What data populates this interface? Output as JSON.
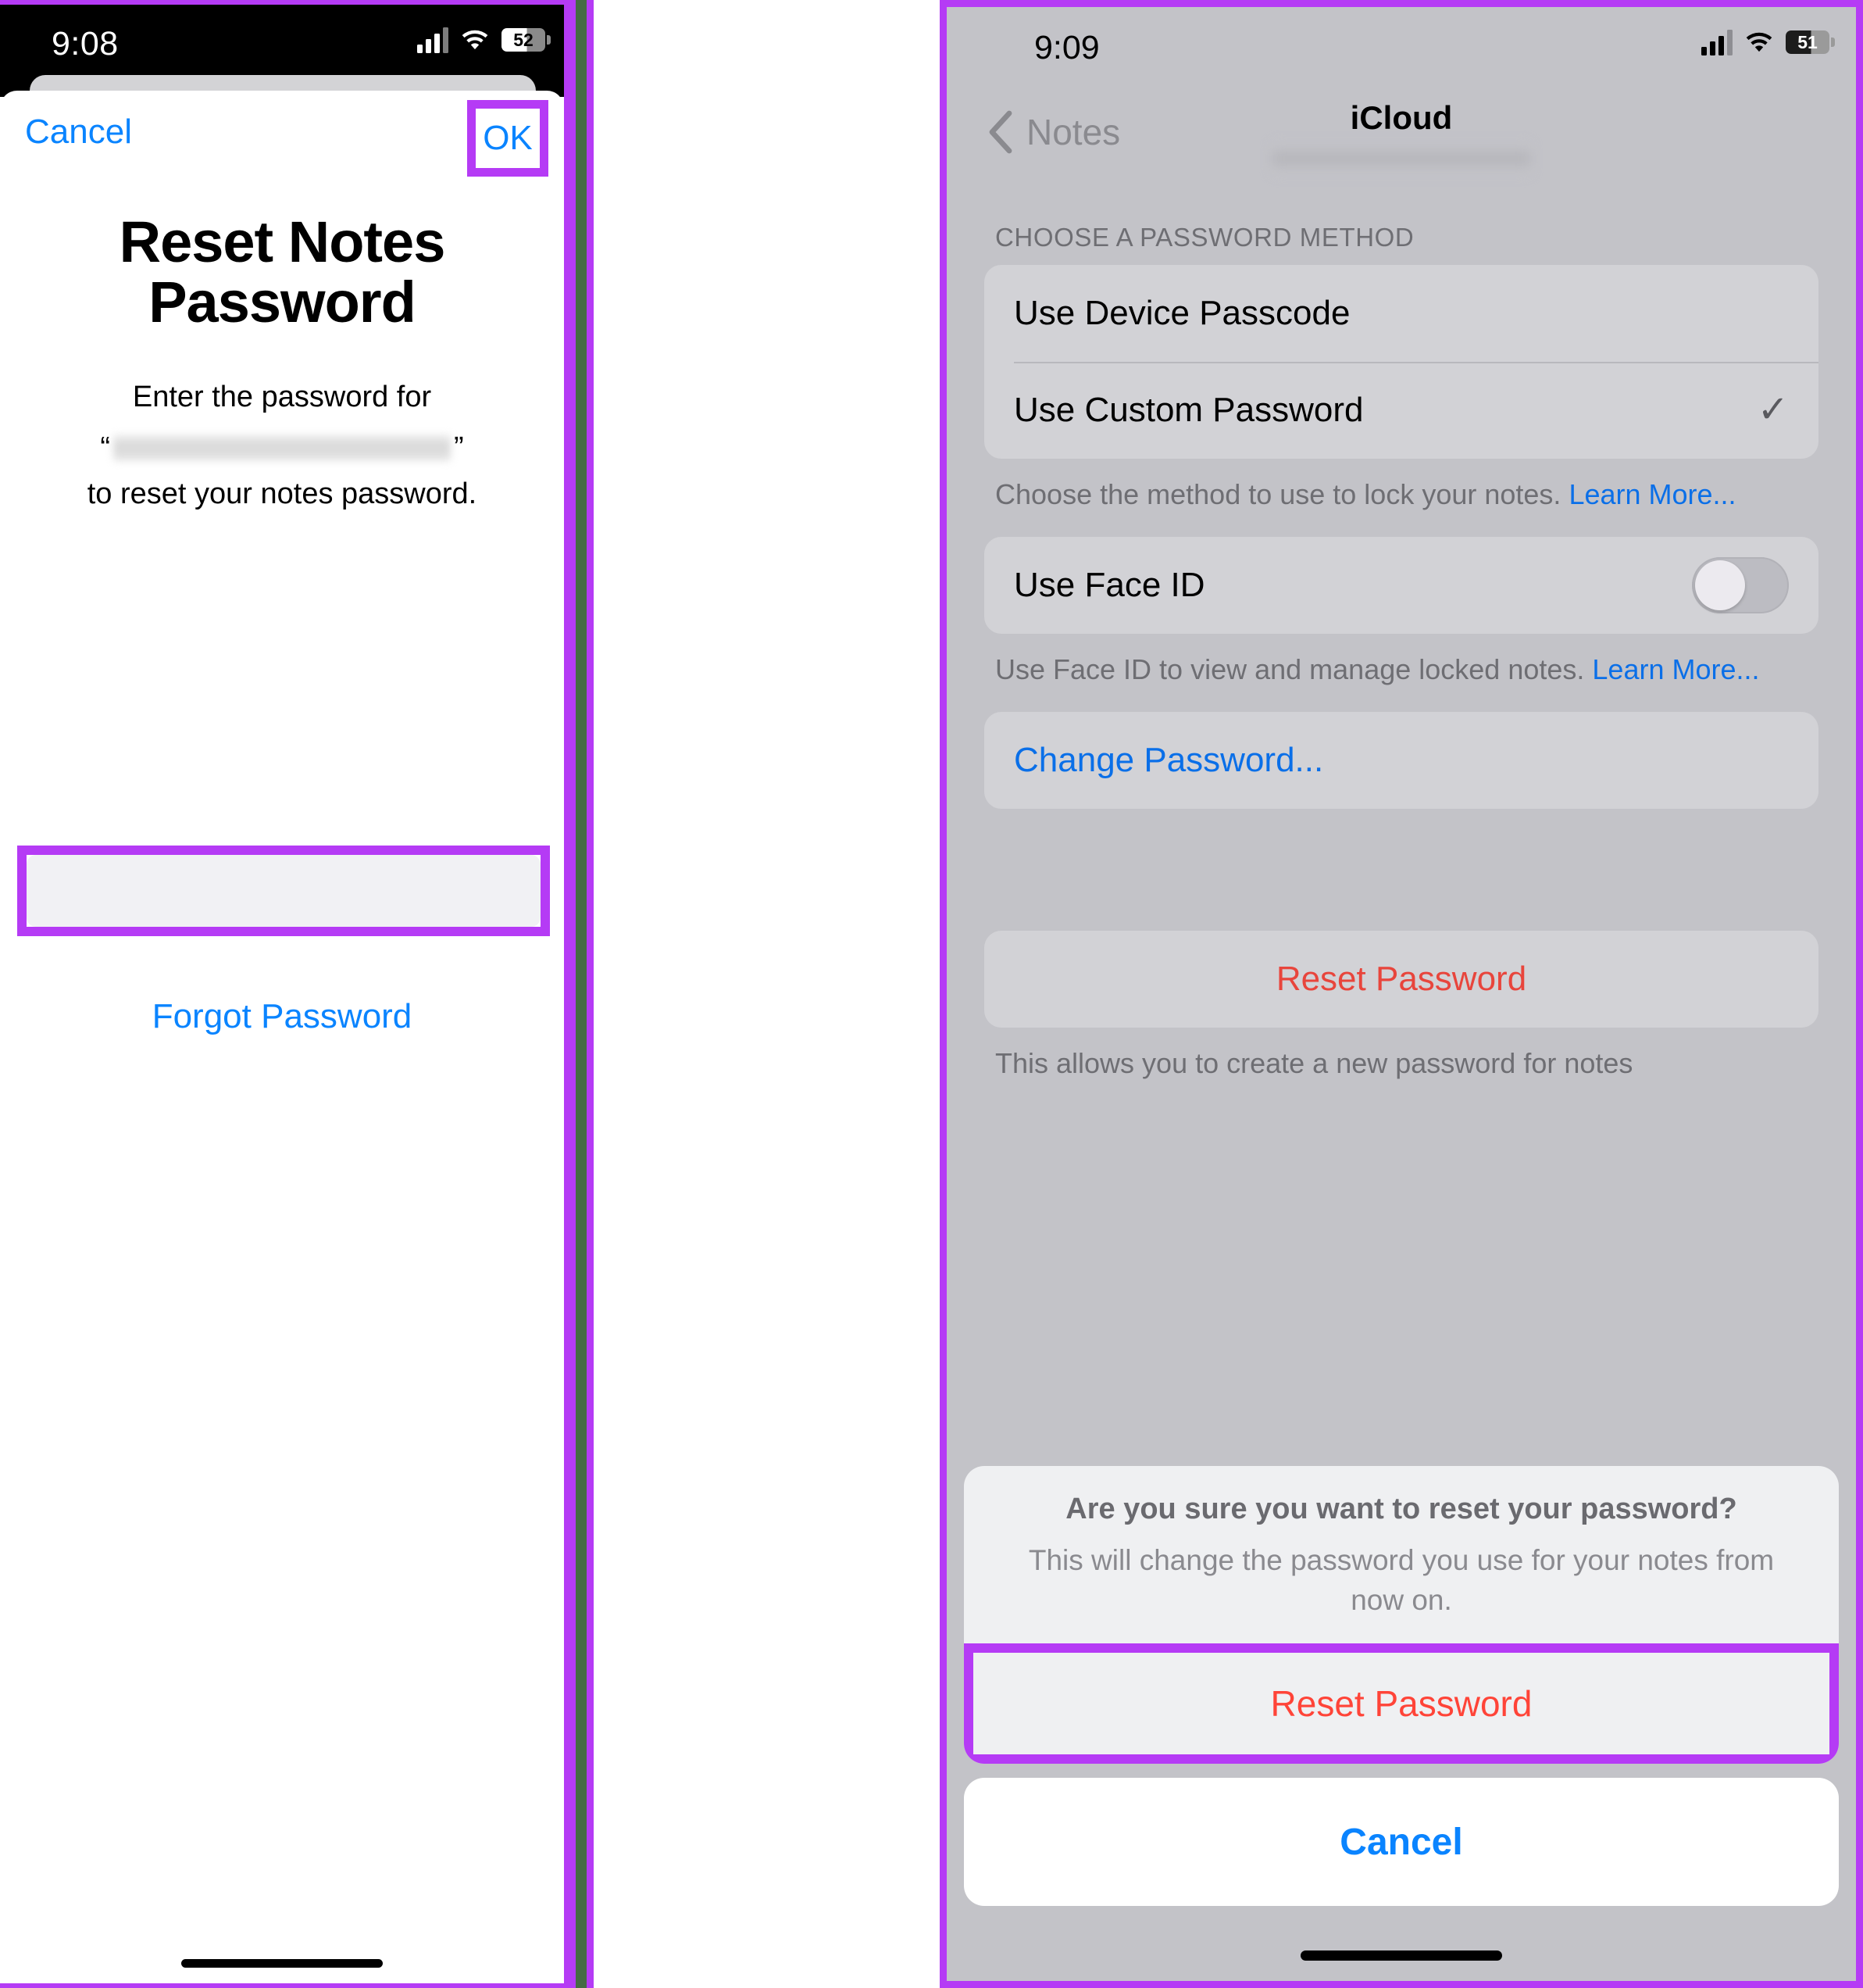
{
  "left_screen": {
    "status_bar": {
      "time": "9:08",
      "battery_percent": "52",
      "cellular_icon": "cellular-bars-icon",
      "wifi_icon": "wifi-icon",
      "battery_icon": "battery-icon"
    },
    "dialog": {
      "cancel_label": "Cancel",
      "ok_label": "OK",
      "title": "Reset Notes Password",
      "message_line1": "Enter the password for",
      "message_quote_open": "“",
      "message_quote_close": "”",
      "message_redacted_value": "",
      "message_line3": "to reset your notes password.",
      "password_input_value": "",
      "password_input_placeholder": "",
      "forgot_password_label": "Forgot Password"
    },
    "home_indicator": "home-indicator"
  },
  "right_screen": {
    "status_bar": {
      "time": "9:09",
      "battery_percent": "51",
      "cellular_icon": "cellular-bars-icon",
      "wifi_icon": "wifi-icon",
      "battery_icon": "battery-icon"
    },
    "nav": {
      "back_label": "Notes",
      "back_icon": "chevron-left-icon",
      "title": "iCloud",
      "subtitle_redacted": ""
    },
    "section_header": "CHOOSE A PASSWORD METHOD",
    "method_rows": [
      {
        "label": "Use Device Passcode",
        "checked": false,
        "check_glyph": ""
      },
      {
        "label": "Use Custom Password",
        "checked": true,
        "check_glyph": "✓"
      }
    ],
    "method_footnote": "Choose the method to use to lock your notes. ",
    "method_footnote_link": "Learn More...",
    "faceid_row": {
      "label": "Use Face ID",
      "toggle_state": "off",
      "toggle_icon": "toggle-switch-icon"
    },
    "faceid_footnote": "Use Face ID to view and manage locked notes. ",
    "faceid_footnote_link": "Learn More...",
    "change_password_label": "Change Password...",
    "reset_password_label": "Reset Password",
    "reset_footnote": "This allows you to create a new password for notes",
    "action_sheet": {
      "title": "Are you sure you want to reset your password?",
      "message": "This will change the password you use for your notes from now on.",
      "destructive_label": "Reset Password",
      "cancel_label": "Cancel"
    },
    "home_indicator": "home-indicator"
  },
  "annotations": {
    "highlight_color": "#b53bf5",
    "accent_blue": "#0a84ff",
    "destructive_red": "#ff4438",
    "link_blue": "#0a6fe8"
  }
}
